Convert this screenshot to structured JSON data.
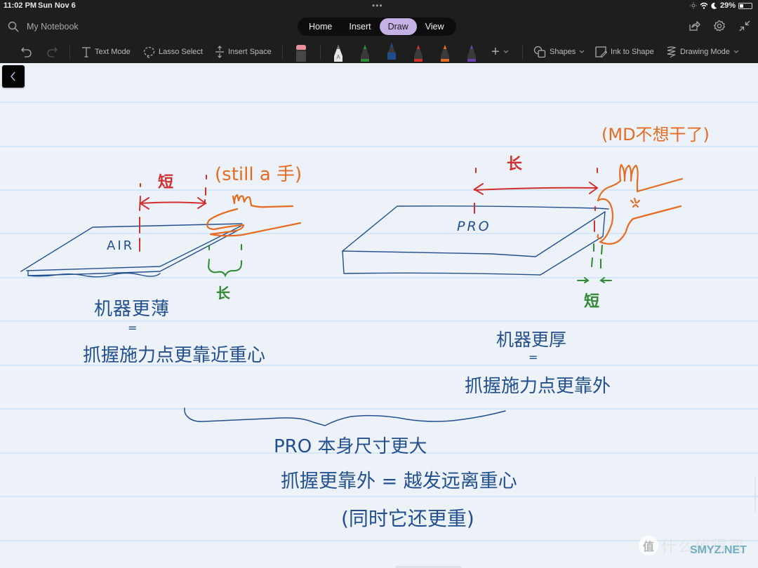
{
  "status_bar": {
    "time": "11:02 PM",
    "date": "Sun Nov 6",
    "more_dots": "•••",
    "battery_percent": "29%",
    "battery_level": 0.29,
    "icons": [
      "brightness-icon",
      "wifi-icon",
      "moon-icon",
      "battery-icon"
    ]
  },
  "header": {
    "notebook_title": "My Notebook",
    "tabs": [
      {
        "label": "Home",
        "active": false
      },
      {
        "label": "Insert",
        "active": false
      },
      {
        "label": "Draw",
        "active": true
      },
      {
        "label": "View",
        "active": false
      }
    ],
    "right_icons": [
      "share-icon",
      "gear-icon",
      "collapse-icon"
    ],
    "accent_color": "#c5b1e6"
  },
  "toolbar": {
    "undo": "undo-icon",
    "redo": "redo-icon",
    "text_mode": "Text Mode",
    "lasso_select": "Lasso Select",
    "insert_space": "Insert Space",
    "eraser": "eraser-icon",
    "pens": [
      {
        "name": "pen-white",
        "color": "#e6e6e6",
        "label": "A"
      },
      {
        "name": "pen-green",
        "color": "#2f8a35"
      },
      {
        "name": "pen-blue",
        "color": "#1f4d8a",
        "selected": true
      },
      {
        "name": "pen-red",
        "color": "#d42f2f"
      },
      {
        "name": "pen-orange",
        "color": "#e56c22"
      },
      {
        "name": "pen-purple",
        "color": "#6a3fb0"
      }
    ],
    "add_pen": "+",
    "shapes": "Shapes",
    "ink_to_shape": "Ink to Shape",
    "drawing_mode": "Drawing Mode"
  },
  "canvas": {
    "ink_colors": {
      "blue": "#22508f",
      "red": "#d42f2f",
      "orange": "#e56c22",
      "green": "#2f8a35"
    },
    "left_sketch": {
      "device_label": "AIR",
      "red_label": "短",
      "orange_note": "(still a 手)",
      "green_label": "长",
      "line1": "机器更薄",
      "equals": "=",
      "line2": "抓握施力点更靠近重心"
    },
    "right_sketch": {
      "device_label": "PRO",
      "red_label": "长",
      "orange_note": "(MD不想干了)",
      "green_label": "短",
      "line1": "机器更厚",
      "equals": "=",
      "line2": "抓握施力点更靠外"
    },
    "summary": {
      "line1": "PRO 本身尺寸更大",
      "line2": "抓握更靠外 = 越发远离重心",
      "line3": "(同时它还更重)"
    }
  },
  "watermark": {
    "badge": "值",
    "text": "什么值得买",
    "site": "SMYZ.NET"
  }
}
